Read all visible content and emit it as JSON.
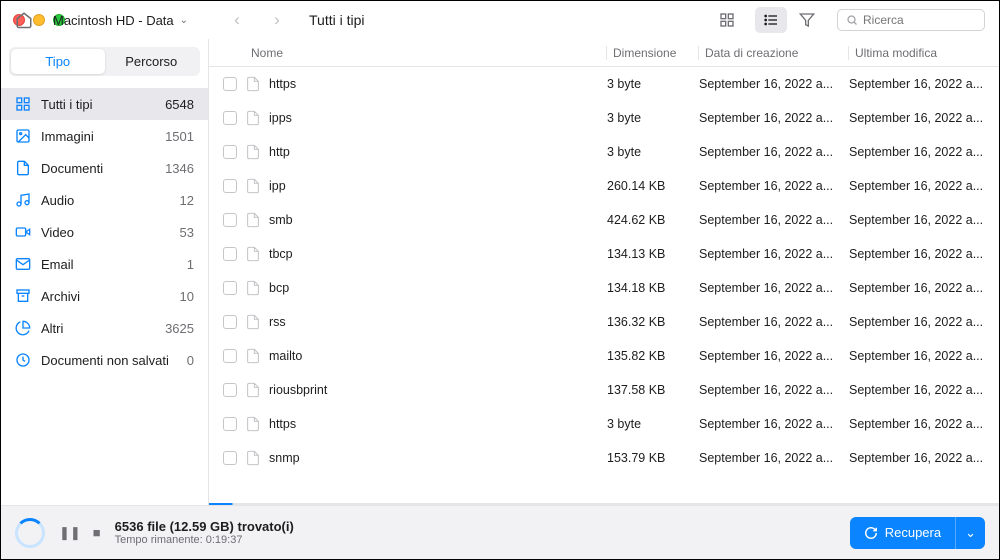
{
  "volume": "Macintosh HD - Data",
  "segments": {
    "type": "Tipo",
    "path": "Percorso"
  },
  "breadcrumb_title": "Tutti i tipi",
  "search_placeholder": "Ricerca",
  "categories": [
    {
      "key": "all",
      "label": "Tutti i tipi",
      "count": "6548",
      "icon": "grid"
    },
    {
      "key": "images",
      "label": "Immagini",
      "count": "1501",
      "icon": "image"
    },
    {
      "key": "docs",
      "label": "Documenti",
      "count": "1346",
      "icon": "doc"
    },
    {
      "key": "audio",
      "label": "Audio",
      "count": "12",
      "icon": "music"
    },
    {
      "key": "video",
      "label": "Video",
      "count": "53",
      "icon": "video"
    },
    {
      "key": "email",
      "label": "Email",
      "count": "1",
      "icon": "mail"
    },
    {
      "key": "archives",
      "label": "Archivi",
      "count": "10",
      "icon": "archive"
    },
    {
      "key": "others",
      "label": "Altri",
      "count": "3625",
      "icon": "pie"
    },
    {
      "key": "unsaved",
      "label": "Documenti non salvati",
      "count": "0",
      "icon": "clock"
    }
  ],
  "columns": {
    "name": "Nome",
    "size": "Dimensione",
    "created": "Data di creazione",
    "modified": "Ultima modifica"
  },
  "files": [
    {
      "name": "https",
      "size": "3 byte",
      "created": "September 16, 2022 a...",
      "modified": "September 16, 2022 a..."
    },
    {
      "name": "ipps",
      "size": "3 byte",
      "created": "September 16, 2022 a...",
      "modified": "September 16, 2022 a..."
    },
    {
      "name": "http",
      "size": "3 byte",
      "created": "September 16, 2022 a...",
      "modified": "September 16, 2022 a..."
    },
    {
      "name": "ipp",
      "size": "260.14 KB",
      "created": "September 16, 2022 a...",
      "modified": "September 16, 2022 a..."
    },
    {
      "name": "smb",
      "size": "424.62 KB",
      "created": "September 16, 2022 a...",
      "modified": "September 16, 2022 a..."
    },
    {
      "name": "tbcp",
      "size": "134.13 KB",
      "created": "September 16, 2022 a...",
      "modified": "September 16, 2022 a..."
    },
    {
      "name": "bcp",
      "size": "134.18 KB",
      "created": "September 16, 2022 a...",
      "modified": "September 16, 2022 a..."
    },
    {
      "name": "rss",
      "size": "136.32 KB",
      "created": "September 16, 2022 a...",
      "modified": "September 16, 2022 a..."
    },
    {
      "name": "mailto",
      "size": "135.82 KB",
      "created": "September 16, 2022 a...",
      "modified": "September 16, 2022 a..."
    },
    {
      "name": "riousbprint",
      "size": "137.58 KB",
      "created": "September 16, 2022 a...",
      "modified": "September 16, 2022 a..."
    },
    {
      "name": "https",
      "size": "3 byte",
      "created": "September 16, 2022 a...",
      "modified": "September 16, 2022 a..."
    },
    {
      "name": "snmp",
      "size": "153.79 KB",
      "created": "September 16, 2022 a...",
      "modified": "September 16, 2022 a..."
    }
  ],
  "footer": {
    "found": "6536 file (12.59 GB) trovato(i)",
    "remaining": "Tempo rimanente: 0:19:37",
    "recover": "Recupera"
  }
}
